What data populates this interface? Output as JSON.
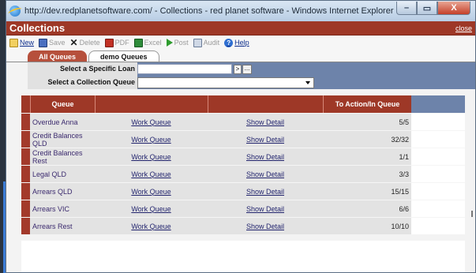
{
  "window": {
    "title": "http://dev.redplanetsoftware.com/ - Collections - red planet software - Windows Internet Explorer",
    "minimize_glyph": "–",
    "maximize_glyph": "▭",
    "close_glyph": "X"
  },
  "header": {
    "title": "Collections",
    "close_label": "close"
  },
  "toolbar": {
    "new_label": "New",
    "save_label": "Save",
    "delete_label": "Delete",
    "pdf_label": "PDF",
    "excel_label": "Excel",
    "post_label": "Post",
    "audit_label": "Audit",
    "help_label": "Help"
  },
  "tabs": [
    {
      "label": "All Queues"
    },
    {
      "label": "demo Queues"
    }
  ],
  "filters": {
    "loan_label": "Select a Specific Loan",
    "loan_value": "",
    "go_glyph": ">",
    "more_glyph": "...",
    "queue_label": "Select a Collection Queue",
    "queue_value": ""
  },
  "grid": {
    "headers": {
      "queue": "Queue",
      "count": "To Action/In Queue"
    },
    "rows": [
      {
        "queue": "Overdue Anna",
        "work": "Work Queue",
        "detail": "Show Detail",
        "count": "5/5"
      },
      {
        "queue": "Credit Balances QLD",
        "work": "Work Queue",
        "detail": "Show Detail",
        "count": "32/32"
      },
      {
        "queue": "Credit Balances Rest",
        "work": "Work Queue",
        "detail": "Show Detail",
        "count": "1/1"
      },
      {
        "queue": "Legal QLD",
        "work": "Work Queue",
        "detail": "Show Detail",
        "count": "3/3"
      },
      {
        "queue": "Arrears QLD",
        "work": "Work Queue",
        "detail": "Show Detail",
        "count": "15/15"
      },
      {
        "queue": "Arrears VIC",
        "work": "Work Queue",
        "detail": "Show Detail",
        "count": "6/6"
      },
      {
        "queue": "Arrears Rest",
        "work": "Work Queue",
        "detail": "Show Detail",
        "count": "10/10"
      }
    ]
  },
  "colors": {
    "brand_red": "#9e3827",
    "filter_blue": "#6d83aa"
  }
}
